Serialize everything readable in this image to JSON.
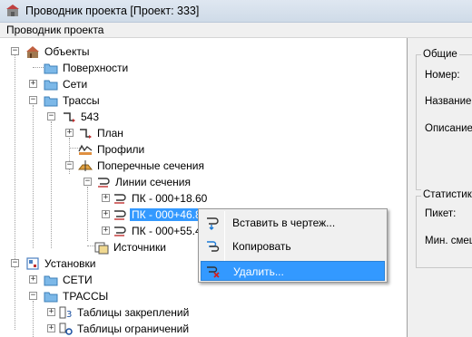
{
  "window": {
    "title": "Проводник проекта [Проект: 333]"
  },
  "menubar": {
    "item": "Проводник проекта"
  },
  "tree": {
    "objects": "Объекты",
    "surfaces": "Поверхности",
    "networks": "Сети",
    "alignments": "Трассы",
    "alignment_543": "543",
    "plan": "План",
    "profiles": "Профили",
    "cross_sections": "Поперечные сечения",
    "section_lines": "Линии сечения",
    "pk1": "ПК - 000+18.60",
    "pk2": "ПК - 000+46.80",
    "pk3": "ПК - 000+55.41",
    "sources": "Источники",
    "settings": "Установки",
    "settings_networks": "СЕТИ",
    "settings_alignments": "ТРАССЫ",
    "tables_fixing": "Таблицы закреплений",
    "tables_limits": "Таблицы ограничений"
  },
  "context_menu": {
    "insert": "Вставить в чертеж...",
    "copy": "Копировать",
    "delete": "Удалить..."
  },
  "properties": {
    "general_group": "Общие",
    "number": "Номер:",
    "name": "Название",
    "description": "Описание",
    "stats_group": "Статистик",
    "station": "Пикет:",
    "min_offset": "Мин. смещ"
  },
  "colors": {
    "selection": "#3399ff",
    "folder": "#7cb8e8",
    "tree_bg": "#ffffff"
  }
}
